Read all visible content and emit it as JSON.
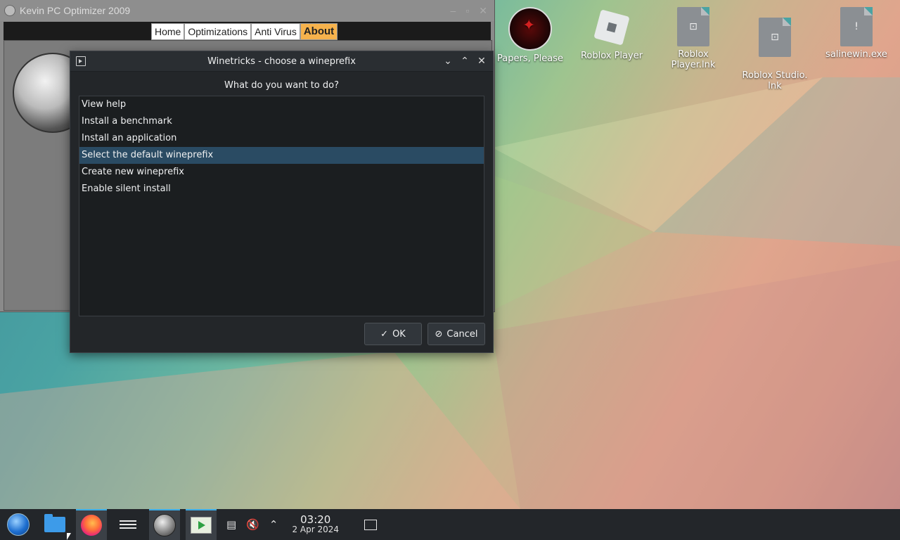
{
  "kevin_window": {
    "title": "Kevin PC Optimizer 2009",
    "tabs": [
      "Home",
      "Optimizations",
      "Anti Virus",
      "About"
    ],
    "active_tab": "About"
  },
  "dialog": {
    "title": "Winetricks - choose a wineprefix",
    "question": "What do you want to do?",
    "items": [
      "View help",
      "Install a benchmark",
      "Install an application",
      "Select the default wineprefix",
      "Create new wineprefix",
      "Enable silent install"
    ],
    "selected_index": 3,
    "ok_label": "OK",
    "cancel_label": "Cancel"
  },
  "desktop_icons": [
    {
      "label": "Papers, Please",
      "icon": "papers-please-icon"
    },
    {
      "label": "Roblox Player",
      "icon": "roblox-icon"
    },
    {
      "label": "Roblox Player.lnk",
      "icon": "shortcut-file-icon"
    },
    {
      "label": "Roblox Studio.\nlnk",
      "icon": "shortcut-file-icon"
    },
    {
      "label": "salinewin.exe",
      "icon": "exe-file-icon"
    }
  ],
  "taskbar": {
    "time": "03:20",
    "date": "2 Apr 2024"
  },
  "colors": {
    "selection": "#2a4b63",
    "dialog_bg": "#232629",
    "taskbar_bg": "#23262a",
    "active_tab": "#f6b24c"
  }
}
